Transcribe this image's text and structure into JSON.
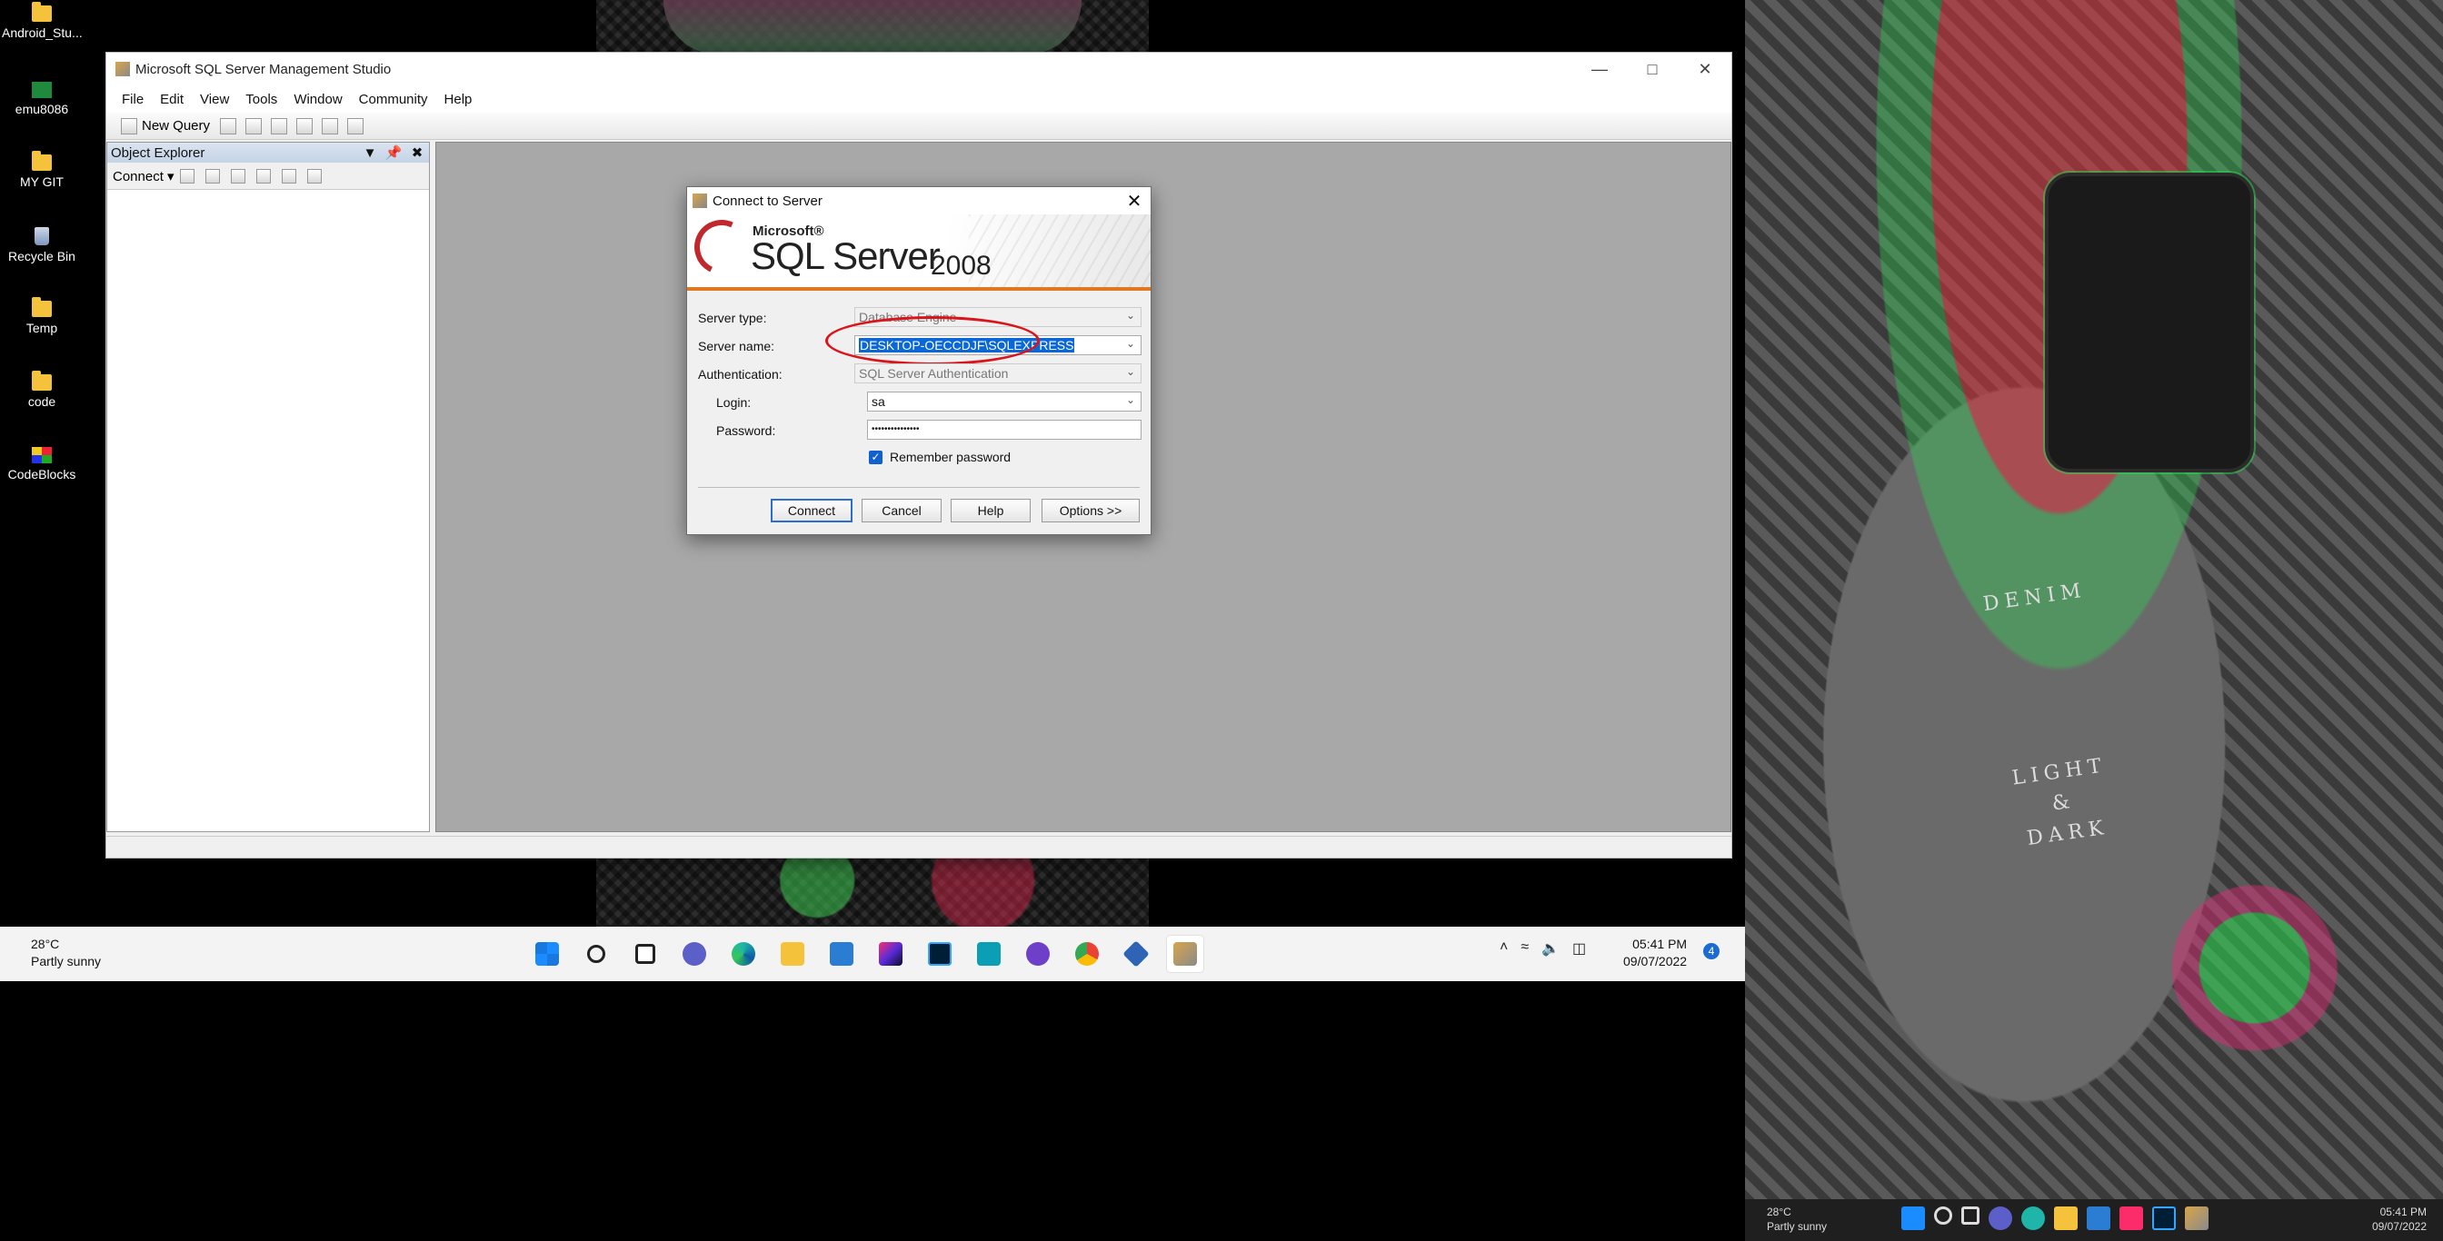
{
  "desktop": {
    "icons": [
      {
        "label": "Android_Stu...",
        "icon": "folder-icon"
      },
      {
        "label": "emu8086",
        "icon": "emu8086-icon"
      },
      {
        "label": "MY GIT",
        "icon": "folder-icon"
      },
      {
        "label": "Recycle Bin",
        "icon": "recycle-bin-icon"
      },
      {
        "label": "Temp",
        "icon": "folder-icon"
      },
      {
        "label": "code",
        "icon": "folder-icon"
      },
      {
        "label": "CodeBlocks",
        "icon": "codeblocks-icon"
      }
    ]
  },
  "ssms": {
    "title": "Microsoft SQL Server Management Studio",
    "menu": [
      "File",
      "Edit",
      "View",
      "Tools",
      "Window",
      "Community",
      "Help"
    ],
    "toolbar": {
      "new_query": "New Query"
    },
    "object_explorer": {
      "title": "Object Explorer",
      "connect": "Connect ▾"
    }
  },
  "dialog": {
    "title": "Connect to Server",
    "banner": {
      "brand": "Microsoft®",
      "product": "SQL Server",
      "year": "2008"
    },
    "labels": {
      "server_type": "Server type:",
      "server_name": "Server name:",
      "authentication": "Authentication:",
      "login": "Login:",
      "password": "Password:"
    },
    "values": {
      "server_type": "Database Engine",
      "server_name": "DESKTOP-OECCDJF\\SQLEXPRESS",
      "authentication": "SQL Server Authentication",
      "login": "sa",
      "password": "•••••••••••••••"
    },
    "remember_password": {
      "label": "Remember password",
      "checked": true
    },
    "buttons": {
      "connect": "Connect",
      "cancel": "Cancel",
      "help": "Help",
      "options": "Options >>"
    },
    "highlight_color": "#d9151b"
  },
  "taskbar": {
    "weather": {
      "temp": "28°C",
      "desc": "Partly sunny"
    },
    "clock": {
      "time": "05:41 PM",
      "date": "09/07/2022"
    },
    "notifications": "4",
    "apps": [
      "windows-start-icon",
      "search-icon",
      "task-view-icon",
      "teams-chat-icon",
      "edge-icon",
      "file-explorer-icon",
      "word-icon",
      "intellij-icon",
      "photoshop-icon",
      "snipping-icon",
      "github-desktop-icon",
      "chrome-icon",
      "virtualbox-icon",
      "ssms-icon"
    ]
  },
  "screen2": {
    "shirt_lines": [
      "DENIM",
      "LIGHT",
      "&",
      "DARK"
    ],
    "weather": {
      "temp": "28°C",
      "desc": "Partly sunny"
    },
    "clock": {
      "time": "05:41 PM",
      "date": "09/07/2022"
    }
  }
}
